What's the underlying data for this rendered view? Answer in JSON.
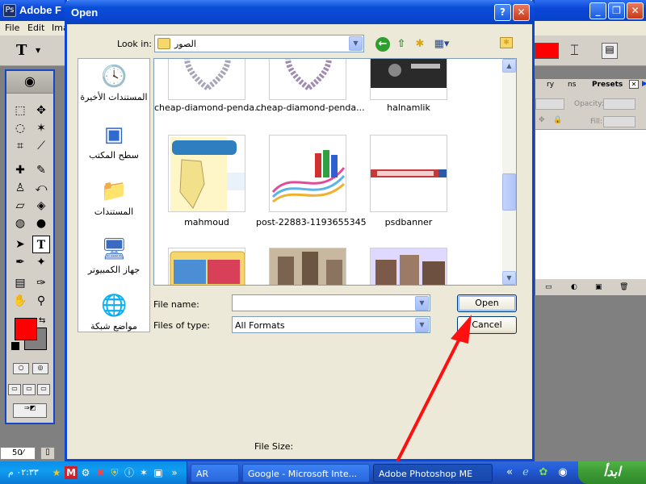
{
  "photoshop": {
    "title": "Adobe F",
    "menu": [
      "File",
      "Edit",
      "Ima"
    ],
    "type_tool_glyph": "T",
    "text_color": "#ff0000",
    "zoom": "50⁄",
    "layers_tabs": [
      "ry",
      "ns",
      "Presets"
    ],
    "opacity_label": "Opacity:",
    "fill_label": "Fill:"
  },
  "dialog": {
    "title": "Open",
    "help_glyph": "?",
    "close_glyph": "✕",
    "look_in_label": "Look in:",
    "look_in_value": "الصور",
    "places": [
      {
        "label": "المستندات الأخيرة",
        "icon": "recent-documents-icon"
      },
      {
        "label": "سطح المكتب",
        "icon": "desktop-icon"
      },
      {
        "label": "المستندات",
        "icon": "my-documents-icon"
      },
      {
        "label": "جهاز الكمبيوتر",
        "icon": "my-computer-icon"
      },
      {
        "label": "مواضع شبكة",
        "icon": "network-places-icon"
      }
    ],
    "files": [
      {
        "name": "cheap-diamond-penda..."
      },
      {
        "name": "cheap-diamond-penda..."
      },
      {
        "name": "halnamlik"
      },
      {
        "name": "mahmoud"
      },
      {
        "name": "post-22883-1193655345"
      },
      {
        "name": "psdbanner"
      },
      {
        "name": ""
      },
      {
        "name": ""
      },
      {
        "name": ""
      }
    ],
    "file_name_label": "File name:",
    "file_name_value": "",
    "files_of_type_label": "Files of type:",
    "files_of_type_value": "All Formats",
    "open_button": "Open",
    "cancel_button": "Cancel",
    "file_size_label": "File Size:"
  },
  "taskbar": {
    "clock": "٠٢:٣٣ م",
    "tasks": [
      {
        "label": "AR",
        "active": false
      },
      {
        "label": "Google - Microsoft Inte...",
        "active": false
      },
      {
        "label": "Adobe Photoshop ME",
        "active": true
      }
    ],
    "start_label": "ابدأ"
  },
  "colors": {
    "arrow": "#ff1010",
    "xp_blue": "#0a46d8"
  }
}
